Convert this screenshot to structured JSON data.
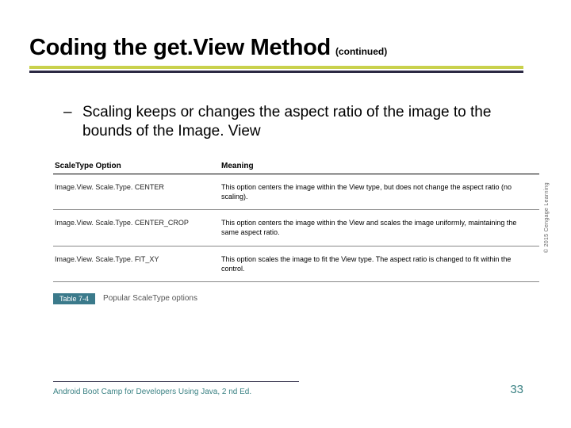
{
  "header": {
    "title": "Coding the get.View Method",
    "continued": "(continued)"
  },
  "bullet": {
    "dash": "–",
    "text": "Scaling keeps or changes the aspect ratio of the image to the bounds of the Image. View"
  },
  "table": {
    "col0": "ScaleType Option",
    "col1": "Meaning",
    "rows": [
      {
        "opt": "Image.View. Scale.Type. CENTER",
        "meaning": "This option centers the image within the View type, but does not change the aspect ratio (no scaling)."
      },
      {
        "opt": "Image.View. Scale.Type. CENTER_CROP",
        "meaning": "This option centers the image within the View and scales the image uniformly, maintaining the same aspect ratio."
      },
      {
        "opt": "Image.View. Scale.Type. FIT_XY",
        "meaning": "This option scales the image to fit the View type. The aspect ratio is changed to fit within the control."
      }
    ],
    "chip": "Table 7-4",
    "caption": "Popular ScaleType options"
  },
  "copyright": "© 2015 Cengage Learning",
  "footer": {
    "text": "Android Boot Camp for Developers Using Java, 2 nd Ed.",
    "page": "33"
  }
}
